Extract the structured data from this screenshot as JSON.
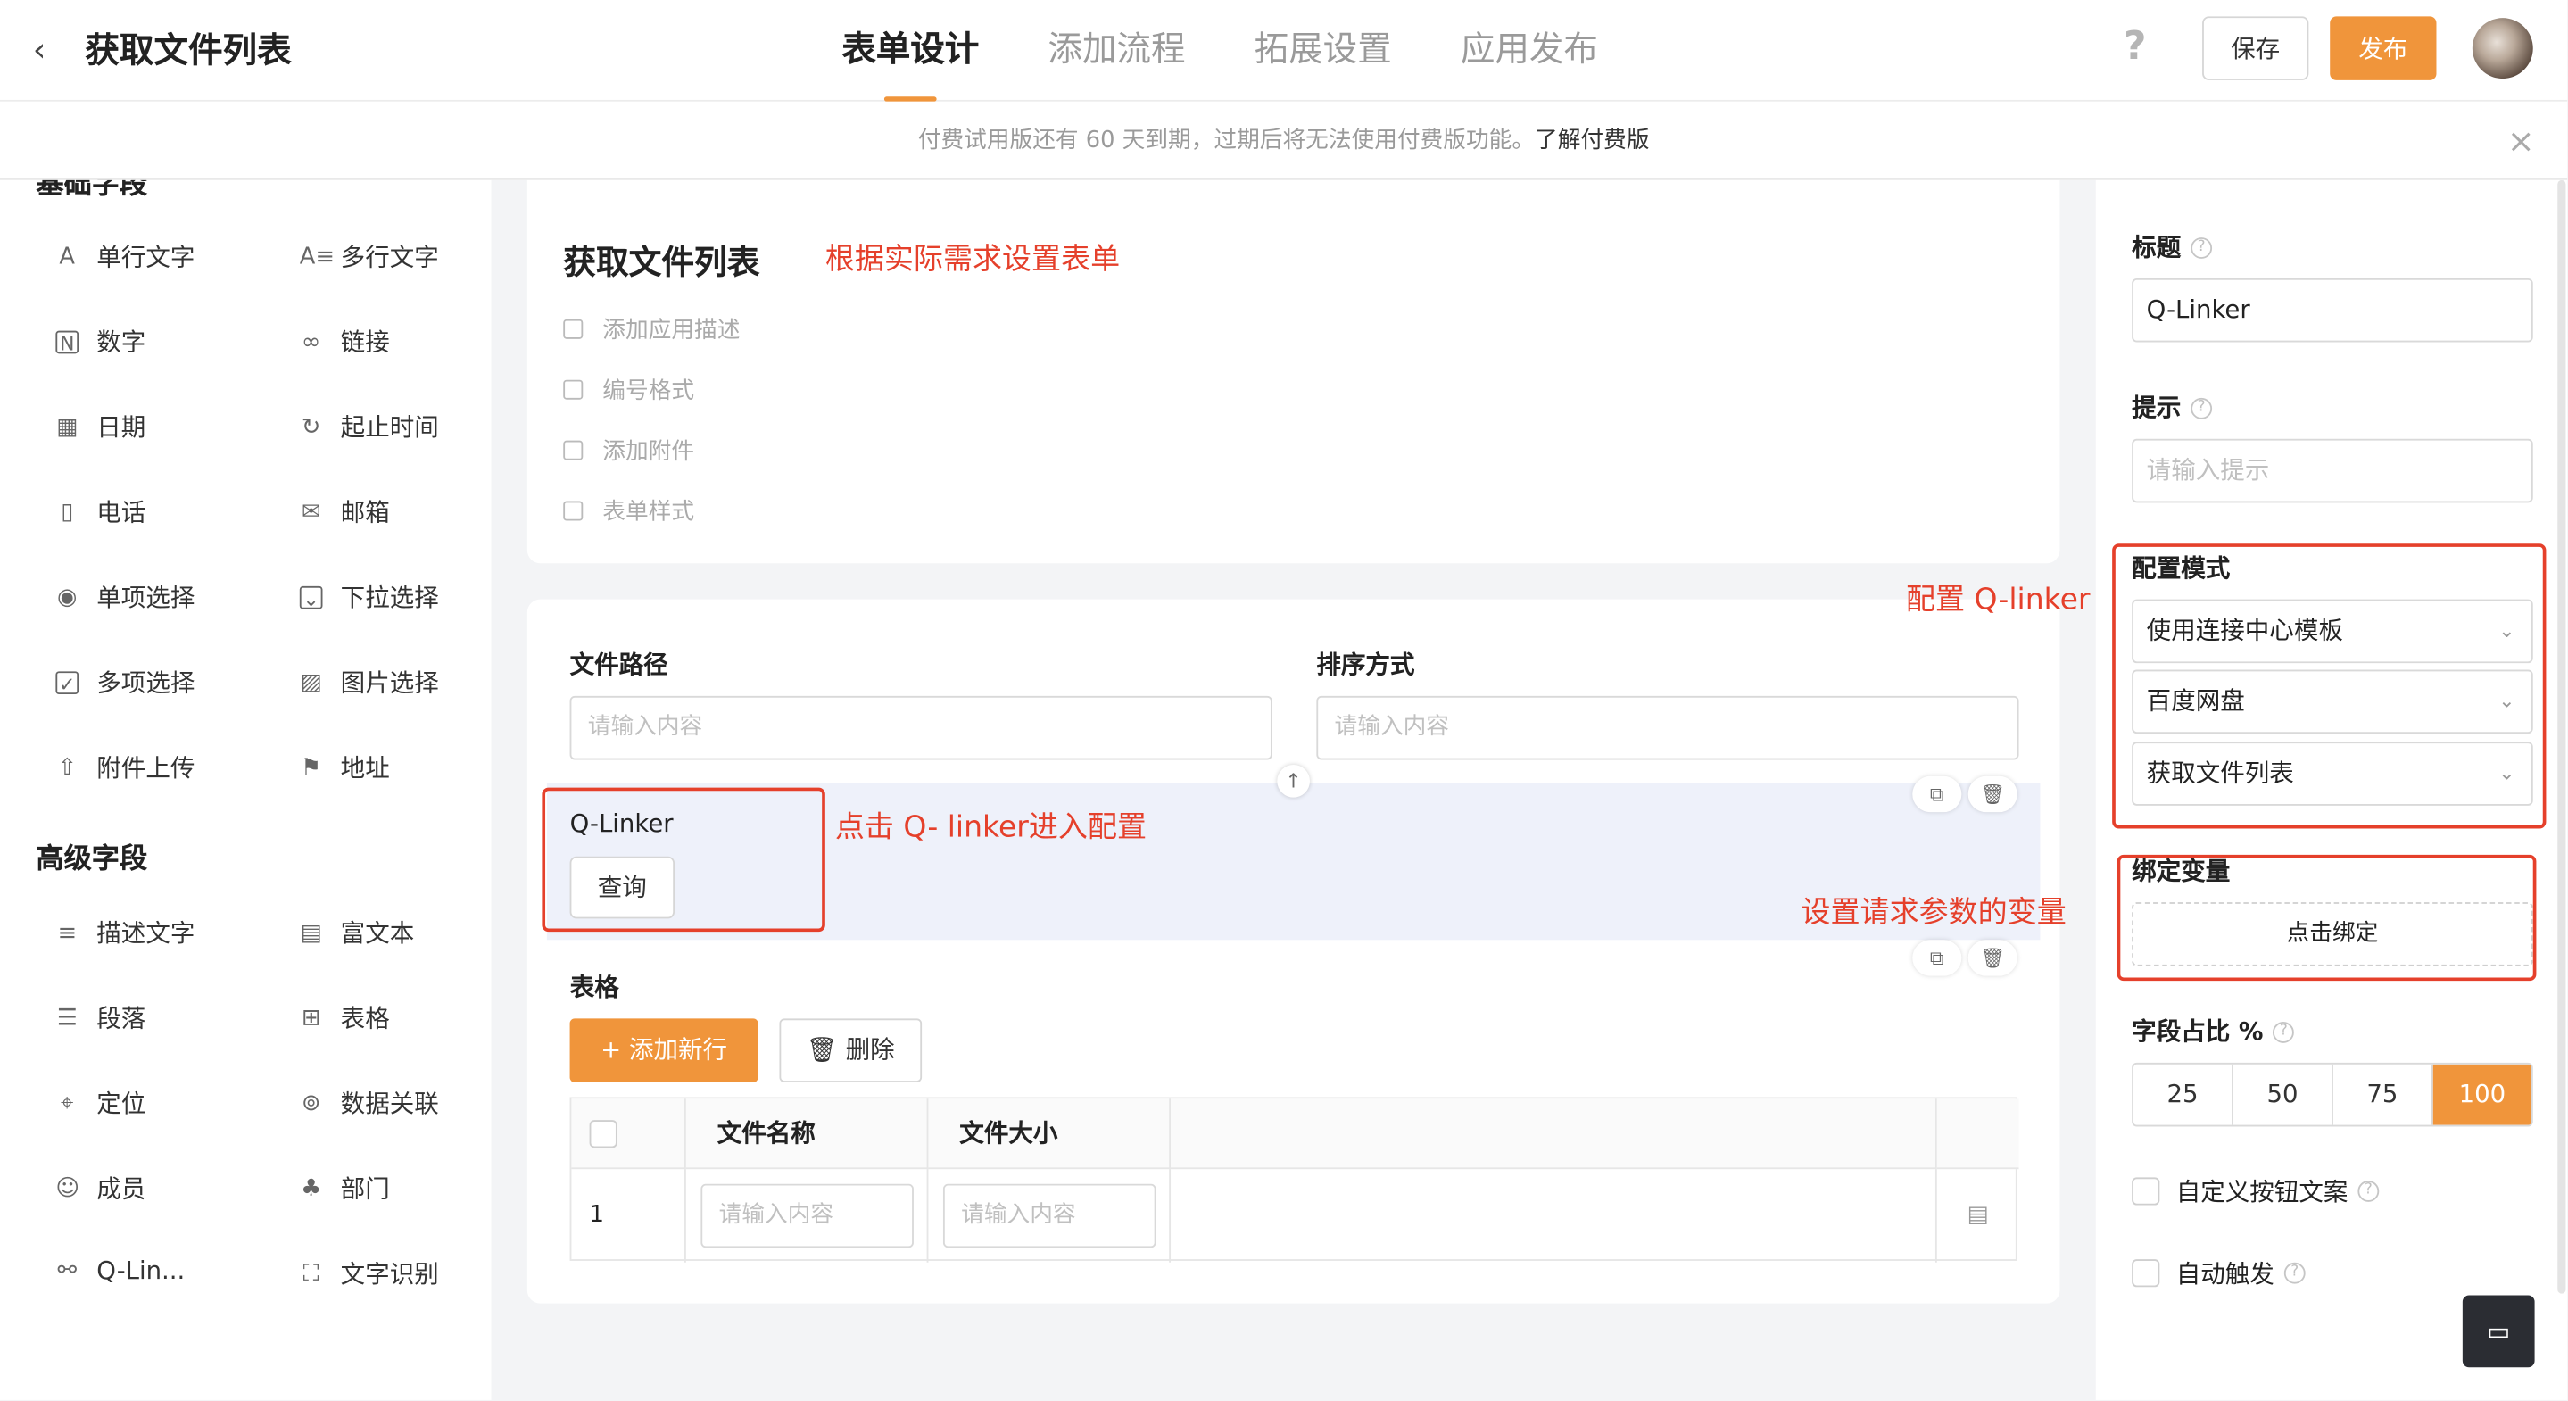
{
  "header": {
    "back_icon": "chevron-left-icon",
    "title": "获取文件列表",
    "tabs": [
      "表单设计",
      "添加流程",
      "拓展设置",
      "应用发布"
    ],
    "help": "?",
    "save": "保存",
    "publish": "发布"
  },
  "notice": {
    "text": "付费试用版还有 60 天到期，过期后将无法使用付费版功能。",
    "link": "了解付费版",
    "close": "×"
  },
  "sidebar": {
    "section1_clipped": "基础字段",
    "basic": [
      {
        "icon": "A",
        "label": "单行文字"
      },
      {
        "icon": "A≡",
        "label": "多行文字"
      },
      {
        "icon": "N",
        "label": "数字"
      },
      {
        "icon": "∞",
        "label": "链接"
      },
      {
        "icon": "▦",
        "label": "日期"
      },
      {
        "icon": "↻",
        "label": "起止时间"
      },
      {
        "icon": "▯",
        "label": "电话"
      },
      {
        "icon": "✉",
        "label": "邮箱"
      },
      {
        "icon": "◉",
        "label": "单项选择"
      },
      {
        "icon": "⌄",
        "label": "下拉选择"
      },
      {
        "icon": "✓",
        "label": "多项选择"
      },
      {
        "icon": "▨",
        "label": "图片选择"
      },
      {
        "icon": "⇧",
        "label": "附件上传"
      },
      {
        "icon": "⚑",
        "label": "地址"
      }
    ],
    "section2": "高级字段",
    "advanced": [
      {
        "icon": "≡",
        "label": "描述文字"
      },
      {
        "icon": "▤",
        "label": "富文本"
      },
      {
        "icon": "☰",
        "label": "段落"
      },
      {
        "icon": "⊞",
        "label": "表格"
      },
      {
        "icon": "⌖",
        "label": "定位"
      },
      {
        "icon": "⊚",
        "label": "数据关联"
      },
      {
        "icon": "☺",
        "label": "成员"
      },
      {
        "icon": "♣",
        "label": "部门"
      },
      {
        "icon": "⚯",
        "label": "Q-Lin..."
      },
      {
        "icon": "⛶",
        "label": "文字识别"
      }
    ]
  },
  "form": {
    "name": "获取文件列表",
    "annotation_top": "根据实际需求设置表单",
    "options": [
      "添加应用描述",
      "编号格式",
      "添加附件",
      "表单样式"
    ],
    "path_label": "文件路径",
    "path_placeholder": "请输入内容",
    "sort_label": "排序方式",
    "sort_placeholder": "请输入内容",
    "qlinker_label": "Q-Linker",
    "query_button": "查询",
    "annotation_qlinker": "点击 Q- linker进入配置",
    "table_label": "表格",
    "add_row": "+ 添加新行",
    "delete": "删除",
    "columns": [
      "文件名称",
      "文件大小"
    ],
    "rows": [
      {
        "index": "1",
        "name_placeholder": "请输入内容",
        "size_placeholder": "请输入内容"
      }
    ]
  },
  "panel": {
    "title_label": "标题",
    "title_value": "Q-Linker",
    "hint_label": "提示",
    "hint_placeholder": "请输入提示",
    "config_label": "配置模式",
    "annotation_config": "配置 Q-linker",
    "selects": [
      "使用连接中心模板",
      "百度网盘",
      "获取文件列表"
    ],
    "bind_label": "绑定变量",
    "annotation_bind": "设置请求参数的变量",
    "bind_button": "点击绑定",
    "ratio_label": "字段占比 %",
    "ratios": [
      "25",
      "50",
      "75",
      "100"
    ],
    "ratio_selected": "100",
    "custom_btn": "自定义按钮文案",
    "auto_trigger": "自动触发"
  },
  "colors": {
    "accent": "#f0953b",
    "annotation": "#e5402b"
  }
}
